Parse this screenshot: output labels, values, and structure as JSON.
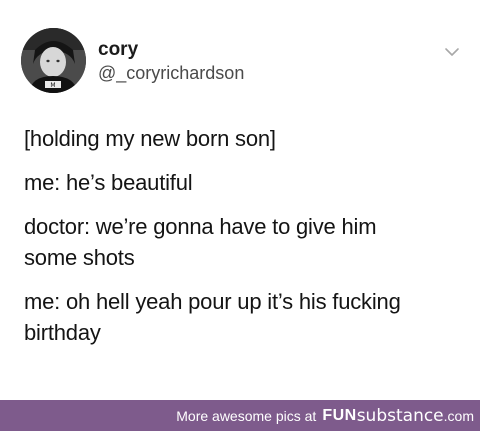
{
  "tweet": {
    "user": {
      "display_name": "cory",
      "handle": "@_coryrichardson",
      "avatar_icon": "profile-photo"
    },
    "menu_icon": "chevron-down-icon",
    "body_paragraphs": [
      {
        "lines": [
          "[holding my new born son]"
        ]
      },
      {
        "lines": [
          "me: he’s beautiful"
        ]
      },
      {
        "lines": [
          "doctor: we’re gonna have to give him",
          "some shots"
        ]
      },
      {
        "lines": [
          "me: oh hell yeah pour up it’s his fucking",
          "birthday"
        ]
      }
    ]
  },
  "footer": {
    "promo_text": "More awesome pics at",
    "brand_fun": "FUN",
    "brand_sub": "substance",
    "brand_com": ".com",
    "background_color": "#7e5b8c"
  }
}
